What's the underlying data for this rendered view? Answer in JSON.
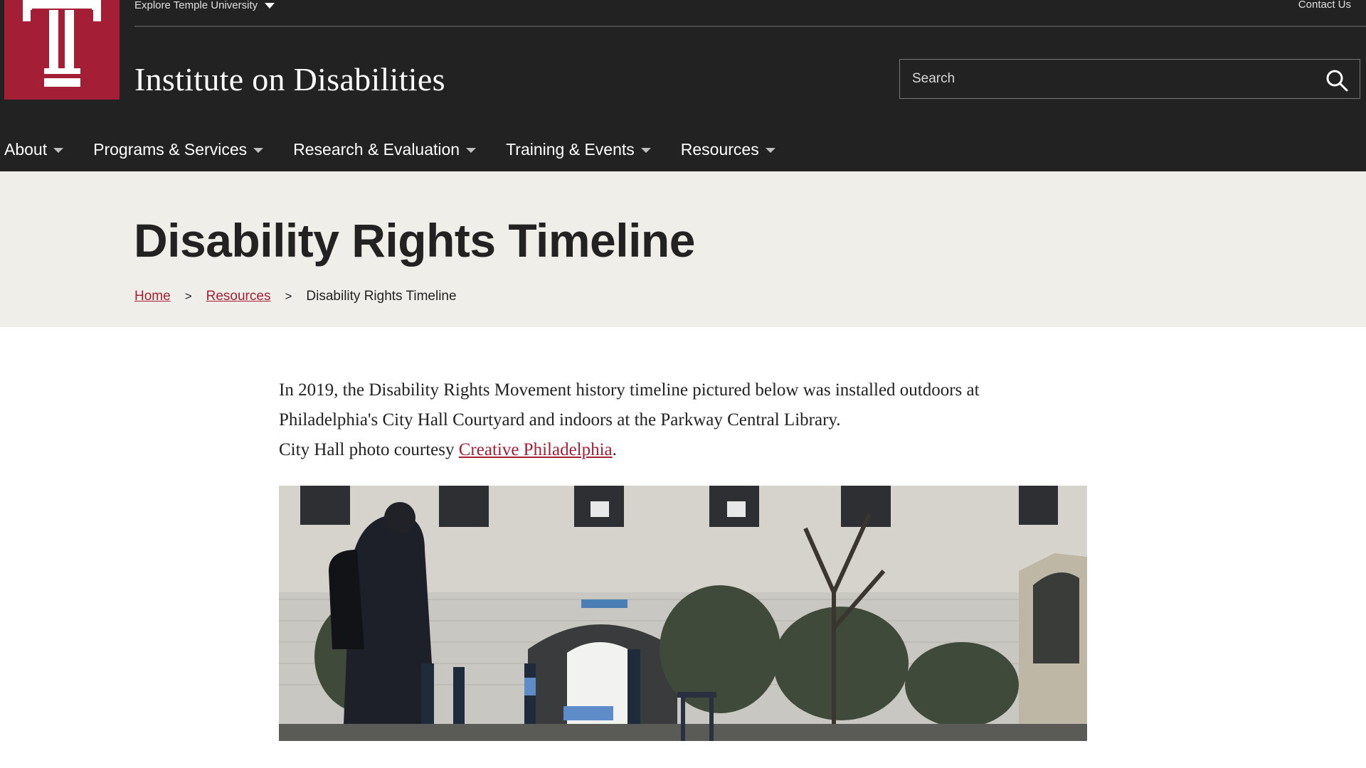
{
  "colors": {
    "header_bg": "#222222",
    "brand_red": "#a41e35",
    "banner_bg": "#f0eee9",
    "link": "#a41e35"
  },
  "header": {
    "explore_label": "Explore Temple University",
    "contact_label": "Contact Us",
    "site_title": "Institute on Disabilities",
    "search_placeholder": "Search",
    "logo_icon": "temple-t-logo-icon",
    "search_icon": "search-icon"
  },
  "nav": {
    "items": [
      {
        "label": "About"
      },
      {
        "label": "Programs & Services"
      },
      {
        "label": "Research & Evaluation"
      },
      {
        "label": "Training & Events"
      },
      {
        "label": "Resources"
      }
    ]
  },
  "banner": {
    "title": "Disability Rights Timeline",
    "breadcrumb": {
      "home": "Home",
      "resources": "Resources",
      "separator": ">",
      "current": "Disability Rights Timeline"
    }
  },
  "main": {
    "intro_line1": "In 2019, the Disability Rights Movement history timeline pictured below was installed outdoors at",
    "intro_line2": "Philadelphia's City Hall Courtyard and indoors at the Parkway Central Library.",
    "intro_line3_prefix": "City Hall photo courtesy ",
    "intro_link": "Creative Philadelphia",
    "intro_line3_suffix": "."
  }
}
